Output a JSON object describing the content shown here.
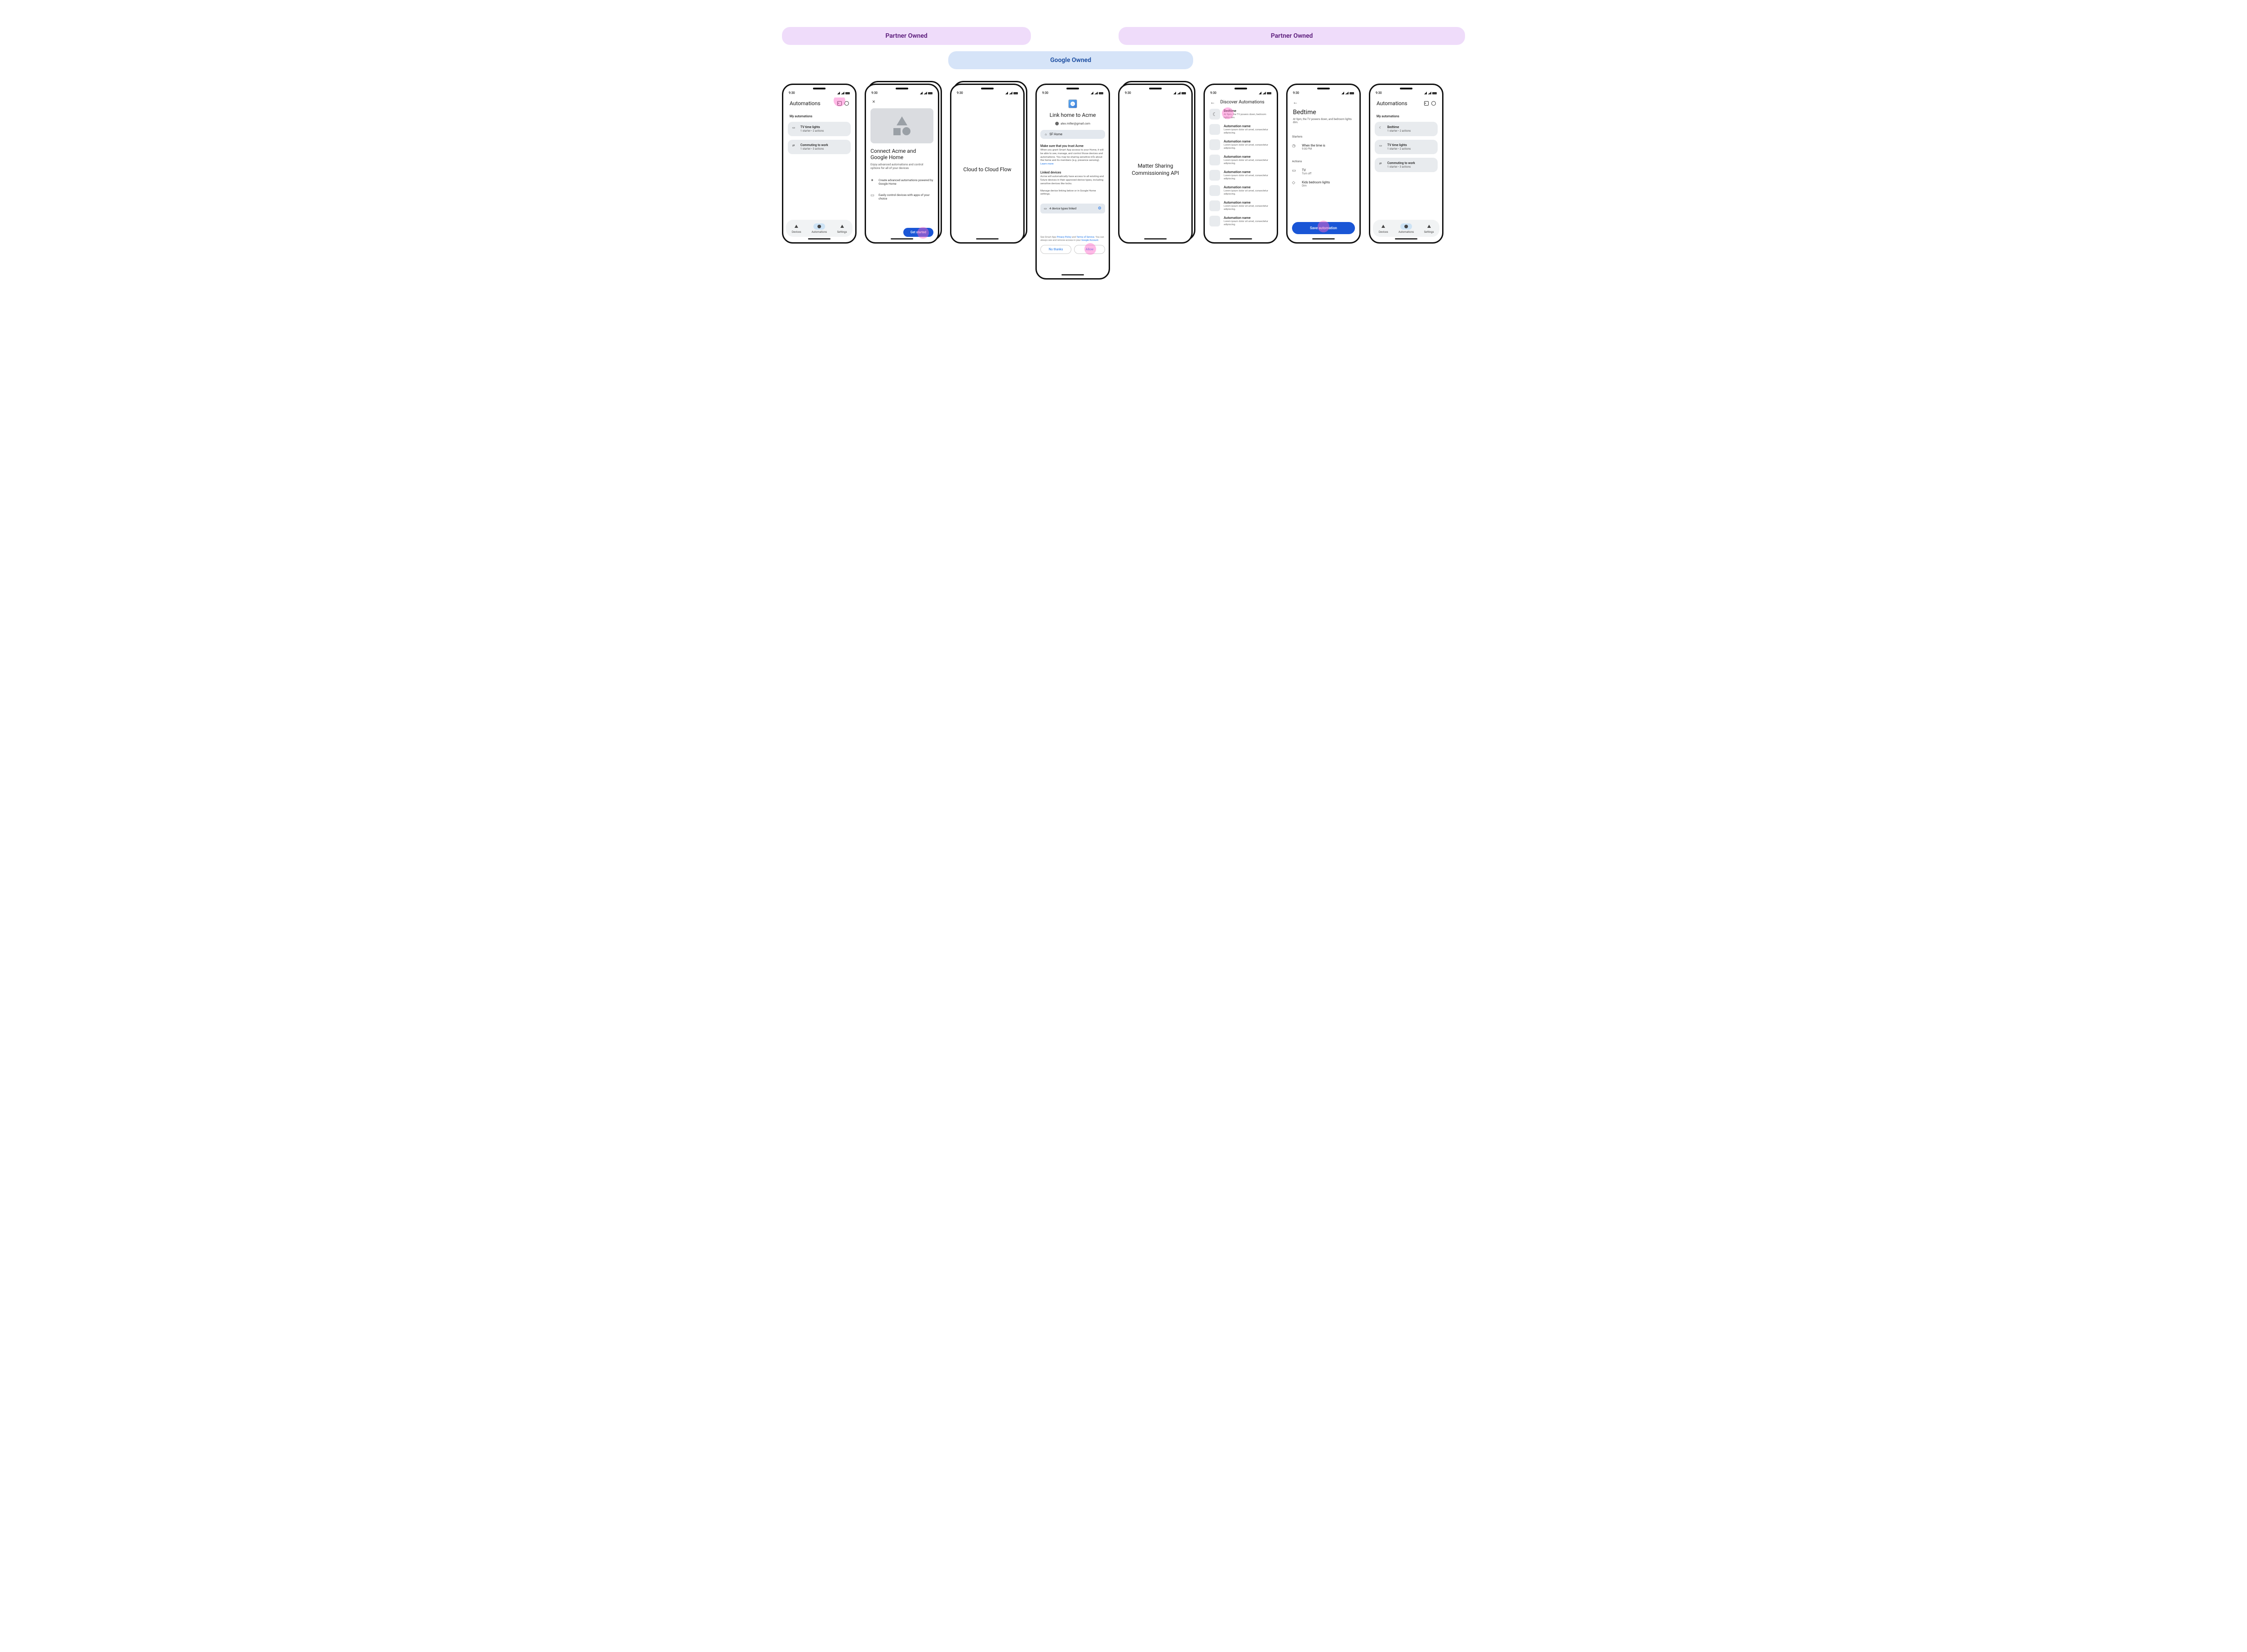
{
  "banners": {
    "partner1": "Partner Owned",
    "google": "Google Owned",
    "partner2": "Partner Owned"
  },
  "status_time": "9:30",
  "phone1": {
    "title": "Automations",
    "section": "My automations",
    "cards": [
      {
        "title": "TV time lights",
        "sub": "1 starter • 2 actions"
      },
      {
        "title": "Commuting to work",
        "sub": "1 starter • 3 actions"
      }
    ],
    "nav": {
      "devices": "Devices",
      "automations": "Automations",
      "settings": "Settings"
    }
  },
  "phone2": {
    "title": "Connect Acme and Google Home",
    "body": "Enjoy advanced automations and control options for all of your devices",
    "feat1": "Create advanced automations powered by Google Home",
    "feat2": "Easily control devices with apps of your choice",
    "button": "Get started"
  },
  "phone3": {
    "title": "Cloud to Cloud Flow"
  },
  "phone4": {
    "title": "Link home to Acme",
    "email": "alex.miller@gmail.com",
    "home": "SF Home",
    "trust_h": "Make sure that you trust Acme",
    "trust_body_1": "When you grant Smart App access to your Home, it will be able to  see, manage, and control those devices and automations. You may be sharing sensitive info about the home and its members (e.g. presence sensing). ",
    "trust_link": "Learn more",
    "linked_h": "Linked devices",
    "linked_body": "Acme will automatically have access to all existing and future devices in their approved device types, including sensitive devices like locks.",
    "linked_manage": "Manage device linking below or in Google Home settings.",
    "device_count": "4 device types linked",
    "footer_1": "See Smart App ",
    "footer_pp": "Privacy Policy",
    "footer_and": " and ",
    "footer_tos": "Terms of Service",
    "footer_2": ". You can always see and remove access in your ",
    "footer_ga": "Google Account",
    "footer_3": ".",
    "no_thanks": "No thanks",
    "allow": "Allow"
  },
  "phone5": {
    "title": "Matter Sharing Commissioning API"
  },
  "phone6": {
    "title": "Discover Automations",
    "rows": [
      {
        "title": "Bedtime",
        "sub": "At 9pm, the TV powers down, bedroom lights dim.",
        "icon": true
      },
      {
        "title": "Automation name",
        "sub": "Lorem ipsum dolor sit amet, consectetur adipiscing."
      },
      {
        "title": "Automation name",
        "sub": "Lorem ipsum dolor sit amet, consectetur adipiscing."
      },
      {
        "title": "Automation name",
        "sub": "Lorem ipsum dolor sit amet, consectetur adipiscing."
      },
      {
        "title": "Automation name",
        "sub": "Lorem ipsum dolor sit amet, consectetur adipiscing."
      },
      {
        "title": "Automation name",
        "sub": "Lorem ipsum dolor sit amet, consectetur adipiscing."
      },
      {
        "title": "Automation name",
        "sub": "Lorem ipsum dolor sit amet, consectetur adipiscing."
      },
      {
        "title": "Automation name",
        "sub": "Lorem ipsum dolor sit amet, consectetur adipiscing."
      }
    ]
  },
  "phone7": {
    "title": "Bedtime",
    "sub": "At 9pm, the TV powers down, and bedroom lights dim.",
    "starters_label": "Starters",
    "starter_t": "When the time is",
    "starter_s": "9:00 PM",
    "actions_label": "Actions",
    "a1_t": "TV",
    "a1_s": "Turn off",
    "a2_t": "Kids bedroom lights",
    "a2_s": "Dim",
    "save": "Save automation"
  },
  "phone8": {
    "title": "Automations",
    "section": "My automations",
    "cards": [
      {
        "title": "Bedtime",
        "sub": "1 starter • 2 actions"
      },
      {
        "title": "TV time lights",
        "sub": "1 starter • 2 actions"
      },
      {
        "title": "Commuting to work",
        "sub": "1 starter • 3 actions"
      }
    ],
    "nav": {
      "devices": "Devices",
      "automations": "Automations",
      "settings": "Settings"
    }
  }
}
